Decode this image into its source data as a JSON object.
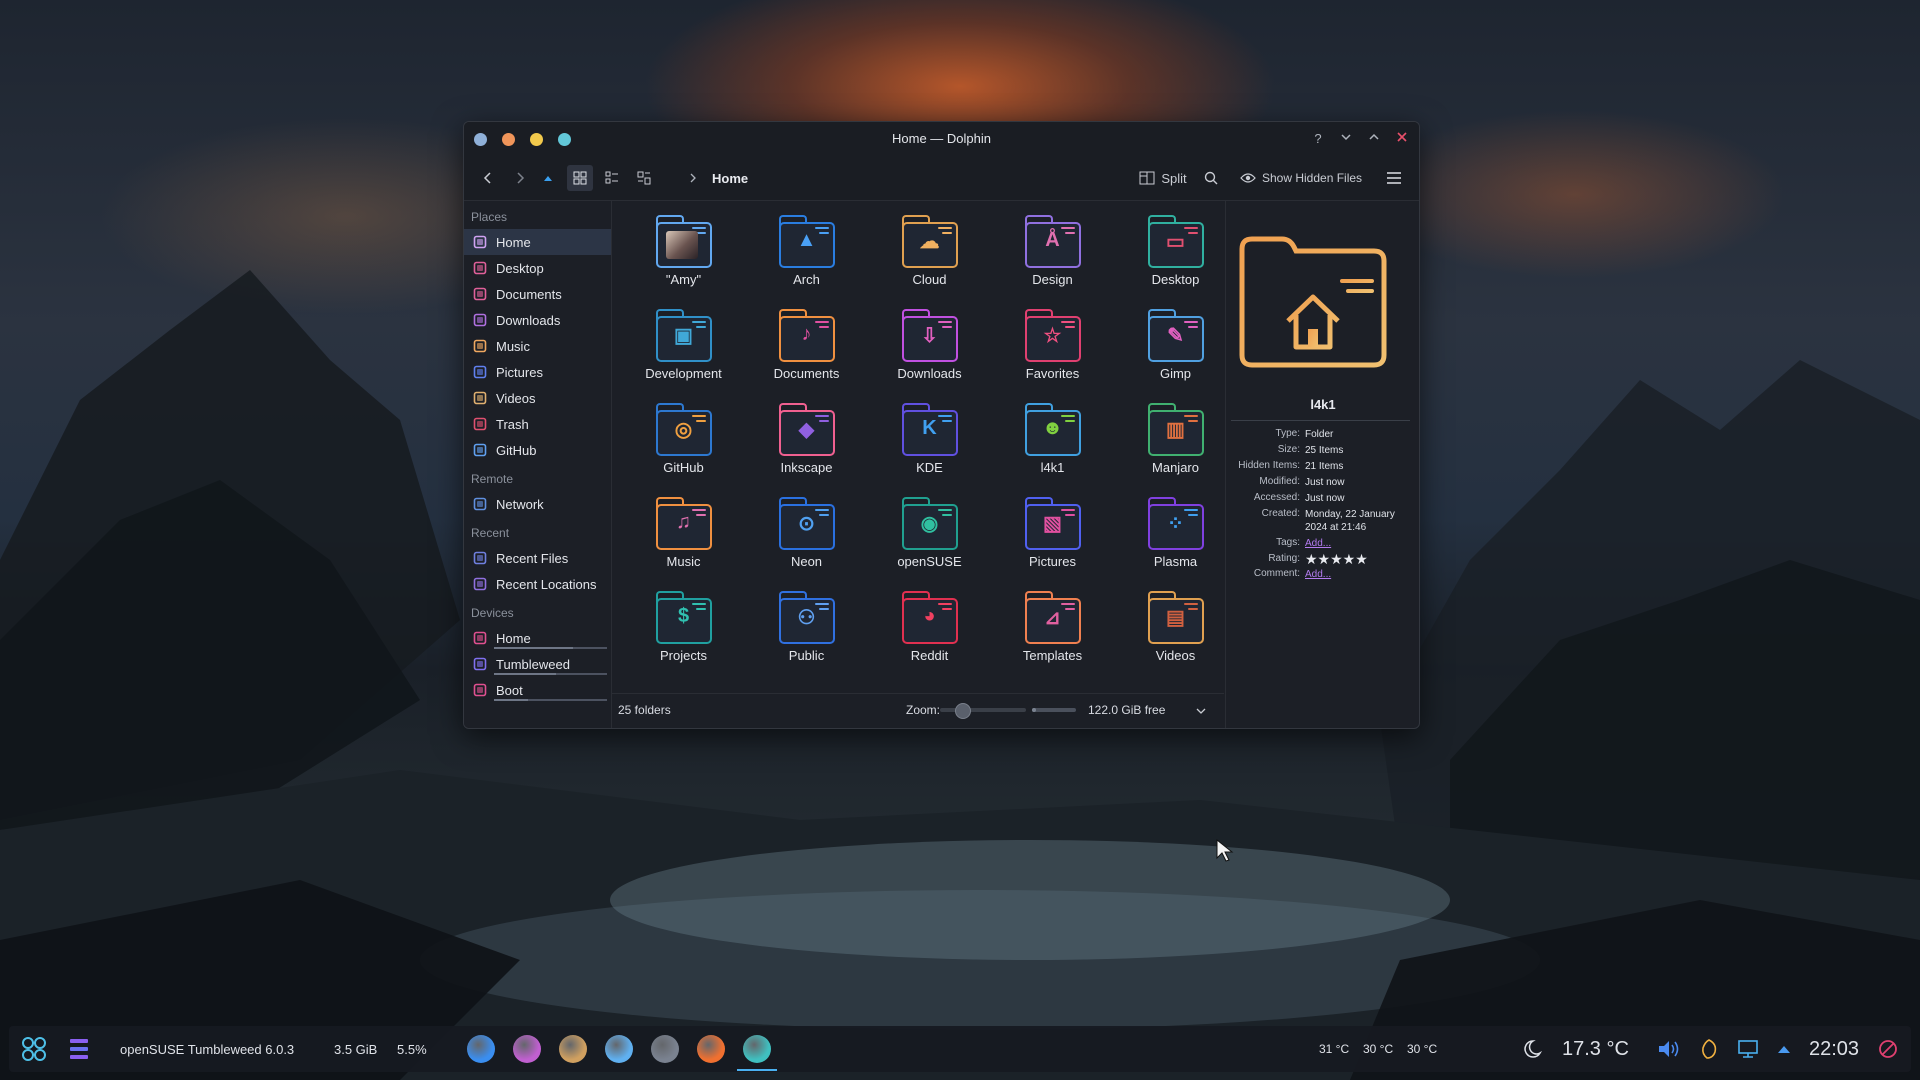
{
  "window": {
    "title": "Home — Dolphin",
    "help_label": "?",
    "breadcrumb": "Home",
    "split_label": "Split",
    "show_hidden_label": "Show Hidden Files",
    "dot_colors": [
      "#8fb0d8",
      "#f0955a",
      "#f2c94c",
      "#62c7d8"
    ]
  },
  "sidebar": {
    "sections": [
      {
        "label": "Places",
        "items": [
          {
            "label": "Home",
            "icon": "home-icon",
            "color": "#d0a2f2"
          },
          {
            "label": "Desktop",
            "icon": "desktop-icon",
            "color": "#e0609a"
          },
          {
            "label": "Documents",
            "icon": "documents-icon",
            "color": "#e0609a"
          },
          {
            "label": "Downloads",
            "icon": "downloads-icon",
            "color": "#b070e0"
          },
          {
            "label": "Music",
            "icon": "music-icon",
            "color": "#f0a860"
          },
          {
            "label": "Pictures",
            "icon": "pictures-icon",
            "color": "#6080f0"
          },
          {
            "label": "Videos",
            "icon": "videos-icon",
            "color": "#e0b070"
          },
          {
            "label": "Trash",
            "icon": "trash-icon",
            "color": "#e05070"
          },
          {
            "label": "GitHub",
            "icon": "github-icon",
            "color": "#60a0f0"
          }
        ]
      },
      {
        "label": "Remote",
        "items": [
          {
            "label": "Network",
            "icon": "network-icon",
            "color": "#6090e0"
          }
        ]
      },
      {
        "label": "Recent",
        "items": [
          {
            "label": "Recent Files",
            "icon": "recent-files-icon",
            "color": "#7080e0"
          },
          {
            "label": "Recent Locations",
            "icon": "recent-locations-icon",
            "color": "#9070e0"
          }
        ]
      },
      {
        "label": "Devices",
        "items": [
          {
            "label": "Home",
            "icon": "drive-icon",
            "color": "#e05090",
            "usage": 0.7
          },
          {
            "label": "Tumbleweed",
            "icon": "drive-icon",
            "color": "#8070f0",
            "usage": 0.55
          },
          {
            "label": "Boot",
            "icon": "drive-icon",
            "color": "#e05090",
            "usage": 0.3
          }
        ]
      }
    ]
  },
  "folders": [
    {
      "label": "\"Amy\"",
      "color": "#62a8f0",
      "accent": "#62a8f0",
      "glyph": ""
    },
    {
      "label": "Arch",
      "color": "#2a7de0",
      "accent": "#4aa0f5",
      "glyph": "▲"
    },
    {
      "label": "Cloud",
      "color": "#e0a050",
      "accent": "#f0b060",
      "glyph": "☁"
    },
    {
      "label": "Design",
      "color": "#9070e0",
      "accent": "#e070b0",
      "glyph": "Å"
    },
    {
      "label": "Desktop",
      "color": "#30b0a0",
      "accent": "#e05070",
      "glyph": "▭"
    },
    {
      "label": "Development",
      "color": "#3090c8",
      "accent": "#40a8d8",
      "glyph": "▣"
    },
    {
      "label": "Documents",
      "color": "#f09040",
      "accent": "#e050a0",
      "glyph": "♪"
    },
    {
      "label": "Downloads",
      "color": "#c050e0",
      "accent": "#e060c0",
      "glyph": "⇩"
    },
    {
      "label": "Favorites",
      "color": "#e04070",
      "accent": "#f05080",
      "glyph": "☆"
    },
    {
      "label": "Gimp",
      "color": "#50a0e0",
      "accent": "#e060c0",
      "glyph": "✎"
    },
    {
      "label": "GitHub",
      "color": "#2d78d0",
      "accent": "#f0a040",
      "glyph": "◎"
    },
    {
      "label": "Inkscape",
      "color": "#f06090",
      "accent": "#9060e0",
      "glyph": "◆"
    },
    {
      "label": "KDE",
      "color": "#6050e0",
      "accent": "#40a0f0",
      "glyph": "K"
    },
    {
      "label": "l4k1",
      "color": "#40a0e0",
      "accent": "#80d040",
      "glyph": "☻"
    },
    {
      "label": "Manjaro",
      "color": "#40b070",
      "accent": "#e07040",
      "glyph": "▥"
    },
    {
      "label": "Music",
      "color": "#f09040",
      "accent": "#e070b0",
      "glyph": "♫"
    },
    {
      "label": "Neon",
      "color": "#2a70e0",
      "accent": "#50a0f0",
      "glyph": "⊙"
    },
    {
      "label": "openSUSE",
      "color": "#20a090",
      "accent": "#30c0a0",
      "glyph": "◉"
    },
    {
      "label": "Pictures",
      "color": "#5060f0",
      "accent": "#e050a0",
      "glyph": "▧"
    },
    {
      "label": "Plasma",
      "color": "#8040e0",
      "accent": "#40a0f0",
      "glyph": "⁘"
    },
    {
      "label": "Projects",
      "color": "#20a0a0",
      "accent": "#30c0b0",
      "glyph": "$"
    },
    {
      "label": "Public",
      "color": "#3070e0",
      "accent": "#60a0f0",
      "glyph": "⚇"
    },
    {
      "label": "Reddit",
      "color": "#e03050",
      "accent": "#f04060",
      "glyph": "◕"
    },
    {
      "label": "Templates",
      "color": "#f08050",
      "accent": "#e060a0",
      "glyph": "⊿"
    },
    {
      "label": "Videos",
      "color": "#e0a050",
      "accent": "#d06040",
      "glyph": "▤"
    }
  ],
  "status": {
    "count_label": "25 folders",
    "zoom_label": "Zoom:",
    "zoom_level": 0.25,
    "free_label": "122.0 GiB free",
    "free_fraction": 0.1
  },
  "info": {
    "name": "l4k1",
    "rows": [
      {
        "label": "Type:",
        "value": "Folder"
      },
      {
        "label": "Size:",
        "value": "25 Items"
      },
      {
        "label": "Hidden Items:",
        "value": "21 Items"
      },
      {
        "label": "Modified:",
        "value": "Just now"
      },
      {
        "label": "Accessed:",
        "value": "Just now"
      },
      {
        "label": "Created:",
        "value": "Monday, 22 January 2024 at 21:46"
      },
      {
        "label": "Tags:",
        "value": "Add...",
        "link": true
      },
      {
        "label": "Rating:",
        "value": "★★★★★",
        "rating": 5
      },
      {
        "label": "Comment:",
        "value": "Add...",
        "link": true
      }
    ]
  },
  "taskbar": {
    "system_name": "openSUSE Tumbleweed 6.0.3",
    "memory": "3.5 GiB",
    "cpu": "5.5%",
    "apps": [
      {
        "icon": "kde-app-icon",
        "color": "#3a8ef0"
      },
      {
        "icon": "steam-app-icon",
        "color": "#c060d0"
      },
      {
        "icon": "gimp-app-icon",
        "color": "#d0a060"
      },
      {
        "icon": "discover-app-icon",
        "color": "#60b0f0"
      },
      {
        "icon": "settings-app-icon",
        "color": "#7a8290"
      },
      {
        "icon": "firefox-app-icon",
        "color": "#f07030"
      },
      {
        "icon": "dolphin-app-icon",
        "color": "#40c0c0"
      }
    ],
    "temps": [
      "31 °C",
      "30 °C",
      "30 °C"
    ],
    "weather": "17.3 °C",
    "clock": "22:03"
  }
}
